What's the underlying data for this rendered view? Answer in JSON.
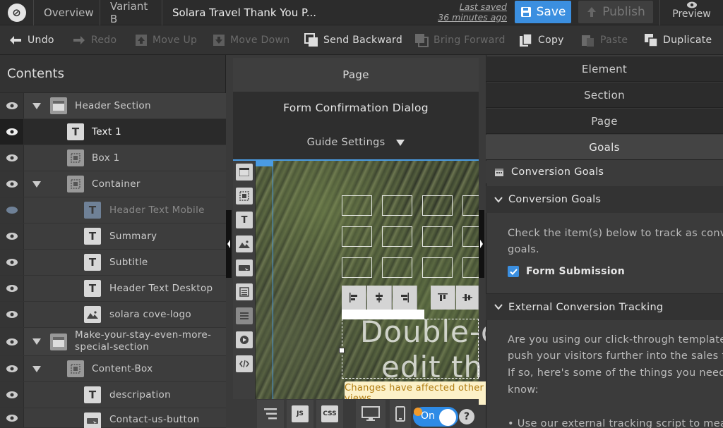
{
  "topbar": {
    "overview_tab": "Overview",
    "variant_tab": "Variant B",
    "page_title": "Solara Travel Thank You P...",
    "last_saved_label": "Last saved",
    "last_saved_time": "36 minutes ago",
    "save_label": "Save",
    "publish_label": "Publish",
    "preview_label": "Preview"
  },
  "toolbar": {
    "undo": "Undo",
    "redo": "Redo",
    "move_up": "Move Up",
    "move_down": "Move Down",
    "send_backward": "Send Backward",
    "bring_forward": "Bring Forward",
    "copy": "Copy",
    "paste": "Paste",
    "duplicate": "Duplicate"
  },
  "contents": {
    "title": "Contents",
    "items": [
      {
        "label": "Header Section",
        "icon": "section-icon",
        "dim": false
      },
      {
        "label": "Text 1",
        "icon": "text-icon",
        "dim": false
      },
      {
        "label": "Box 1",
        "icon": "box-icon",
        "dim": false
      },
      {
        "label": "Container",
        "icon": "box-icon",
        "dim": false
      },
      {
        "label": "Header Text Mobile",
        "icon": "text-icon",
        "dim": true
      },
      {
        "label": "Summary",
        "icon": "text-icon",
        "dim": false
      },
      {
        "label": "Subtitle",
        "icon": "text-icon",
        "dim": false
      },
      {
        "label": "Header Text Desktop",
        "icon": "text-icon",
        "dim": false
      },
      {
        "label": "solara cove-logo",
        "icon": "image-icon",
        "dim": false
      },
      {
        "label": "Make-your-stay-even-more-special-section",
        "icon": "section-icon",
        "dim": false
      },
      {
        "label": "Content-Box",
        "icon": "box-icon",
        "dim": false
      },
      {
        "label": "descripation",
        "icon": "text-icon",
        "dim": false
      },
      {
        "label": "Contact-us-button",
        "icon": "button-icon",
        "dim": false
      }
    ]
  },
  "middle": {
    "page_label": "Page",
    "dialog_label": "Form Confirmation Dialog",
    "guide_settings": "Guide Settings",
    "canvas_text_line1": "Double-c",
    "canvas_text_line2": "edit thi",
    "tooltip": "Changes have affected other views",
    "toggle_label": "On",
    "help_label": "?",
    "js_label": "JS",
    "css_label": "CSS"
  },
  "right": {
    "tabs": [
      "Element",
      "Section",
      "Page",
      "Goals"
    ],
    "conversion_goals_header": "Conversion Goals",
    "conversion_goals_section": "Conversion Goals",
    "track_text_line1": "Check the item(s) below to track as convers",
    "track_text_line2": "goals.",
    "form_submission": "Form Submission",
    "external_tracking": "External Conversion Tracking",
    "ext_line1": "Are you using our click-through templates t",
    "ext_line2": "push your visitors further into the sales fun",
    "ext_line3": "If so, here's some of the things you need to",
    "ext_line4": "know:",
    "bullet1": "Use our external tracking script to measu"
  },
  "colors": {
    "accent": "#3b8fe0",
    "tooltip_bg": "#fcf1c8",
    "tooltip_text": "#b07c10",
    "notification": "#f19a2b"
  }
}
